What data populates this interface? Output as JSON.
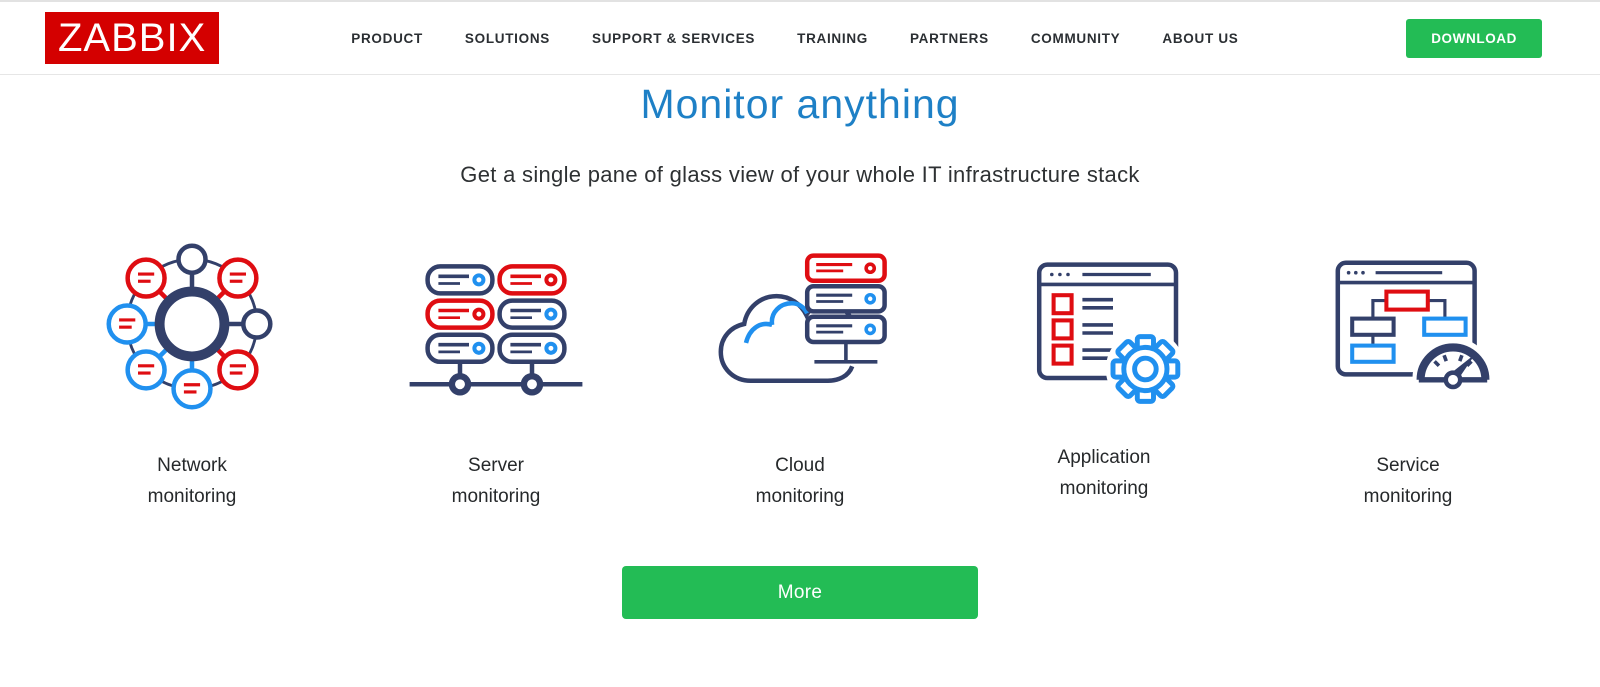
{
  "header": {
    "logo_text": "ZABBIX",
    "nav": [
      {
        "label": "PRODUCT"
      },
      {
        "label": "SOLUTIONS"
      },
      {
        "label": "SUPPORT & SERVICES"
      },
      {
        "label": "TRAINING"
      },
      {
        "label": "PARTNERS"
      },
      {
        "label": "COMMUNITY"
      },
      {
        "label": "ABOUT US"
      }
    ],
    "download_label": "DOWNLOAD"
  },
  "hero": {
    "title": "Monitor anything",
    "subtitle": "Get a single pane of glass view of your whole IT infrastructure stack"
  },
  "features": [
    {
      "line1": "Network",
      "line2": "monitoring",
      "icon": "network-monitoring-icon"
    },
    {
      "line1": "Server",
      "line2": "monitoring",
      "icon": "server-monitoring-icon"
    },
    {
      "line1": "Cloud",
      "line2": "monitoring",
      "icon": "cloud-monitoring-icon"
    },
    {
      "line1": "Application",
      "line2": "monitoring",
      "icon": "application-monitoring-icon"
    },
    {
      "line1": "Service",
      "line2": "monitoring",
      "icon": "service-monitoring-icon"
    }
  ],
  "cta": {
    "more_label": "More"
  },
  "colors": {
    "brand_red": "#d40000",
    "accent_green": "#23bc55",
    "heading_blue": "#1e80c6",
    "icon_navy": "#33406a",
    "icon_red": "#df0d12",
    "icon_blue": "#2090ef"
  }
}
